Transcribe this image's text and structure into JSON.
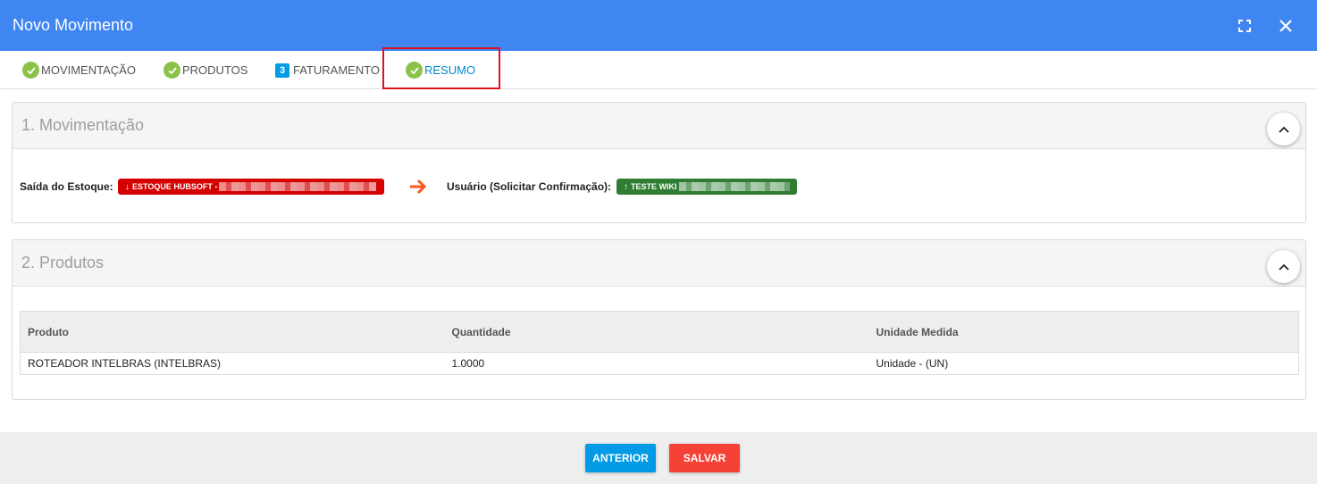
{
  "header": {
    "title": "Novo Movimento",
    "expand_icon": "fullscreen-icon",
    "close_icon": "close-icon"
  },
  "tabs": [
    {
      "label": "MOVIMENTAÇÃO",
      "icon": "check-circle-icon"
    },
    {
      "label": "PRODUTOS",
      "icon": "check-circle-icon"
    },
    {
      "label": "FATURAMENTO",
      "number": "3"
    },
    {
      "label": "RESUMO",
      "icon": "check-circle-icon",
      "active": true
    }
  ],
  "movimentacao": {
    "title": "1. Movimentação",
    "source_label": "Saída do Estoque:",
    "source_value": "ESTOQUE HUBSOFT -",
    "target_label": "Usuário (Solicitar Confirmação):",
    "target_value": "TESTE WIKI"
  },
  "produtos": {
    "title": "2. Produtos",
    "columns": [
      "Produto",
      "Quantidade",
      "Unidade Medida"
    ],
    "rows": [
      [
        "ROTEADOR INTELBRAS (INTELBRAS)",
        "1.0000",
        "Unidade - (UN)"
      ]
    ]
  },
  "footer": {
    "prev_label": "ANTERIOR",
    "save_label": "SALVAR"
  },
  "colors": {
    "header": "#3f86f3",
    "source_badge": "#d50000",
    "target_badge": "#2e7d32",
    "save_button": "#f44336",
    "prev_button": "#039be5"
  }
}
